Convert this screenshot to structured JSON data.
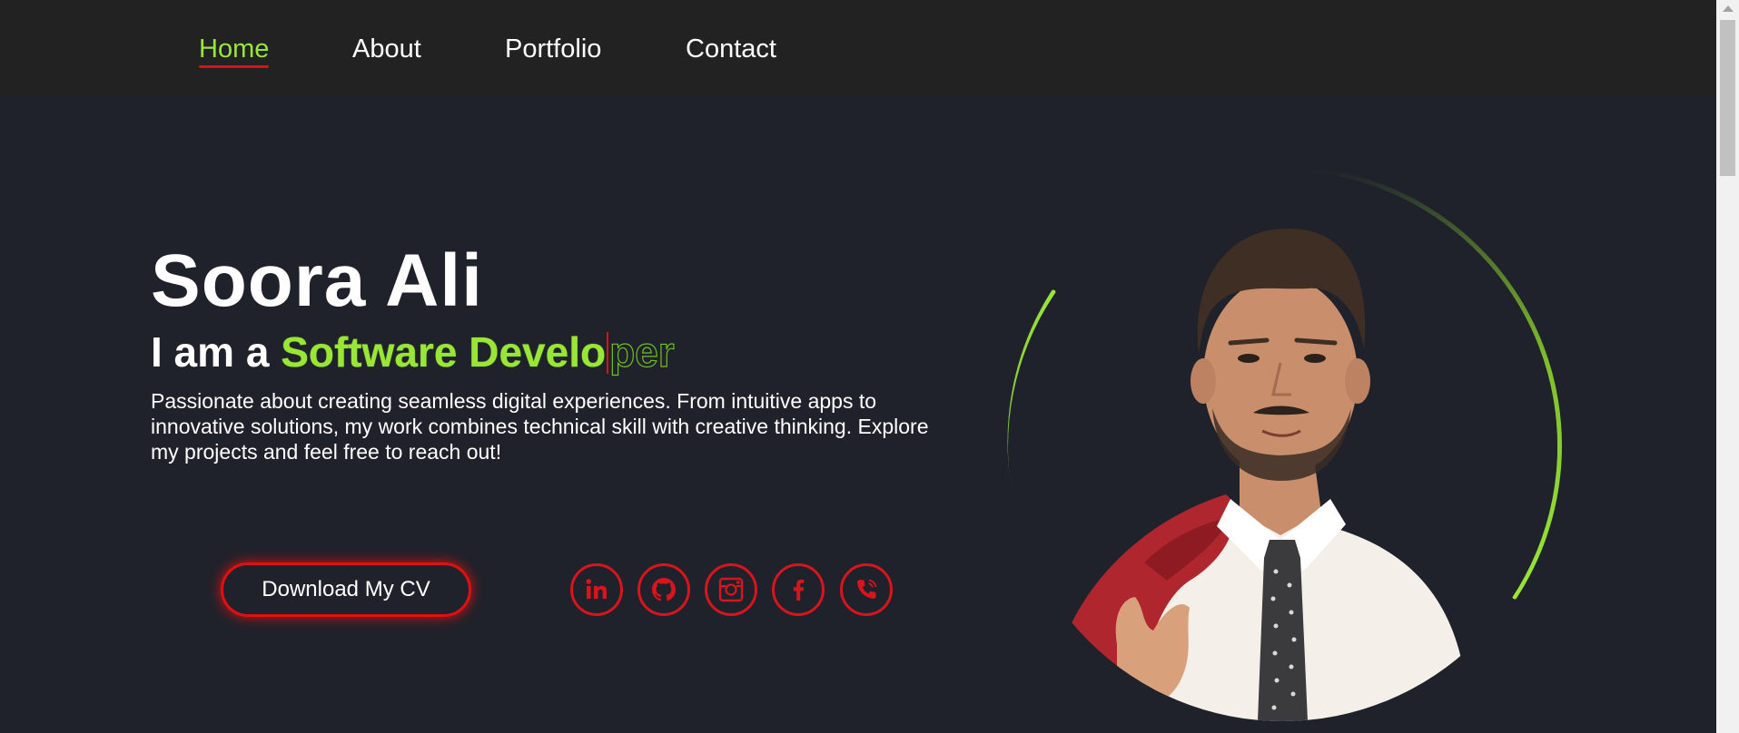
{
  "nav": {
    "items": [
      {
        "label": "Home",
        "active": true
      },
      {
        "label": "About",
        "active": false
      },
      {
        "label": "Portfolio",
        "active": false
      },
      {
        "label": "Contact",
        "active": false
      }
    ]
  },
  "hero": {
    "name": "Soora Ali",
    "role_prefix": "I am a ",
    "role_typed": "Software Develo",
    "role_rest": "per",
    "description": "Passionate about creating seamless digital experiences. From intuitive apps to innovative solutions, my work combines technical skill with creative thinking. Explore my projects and feel free to reach out!",
    "cv_button_label": "Download My CV"
  },
  "social_icons": [
    "linkedin-icon",
    "github-icon",
    "instagram-icon",
    "facebook-icon",
    "phone-icon"
  ],
  "colors": {
    "accent_green": "#9ae636",
    "accent_red": "#e01010",
    "background": "#1f222b",
    "navbar": "#222222"
  }
}
